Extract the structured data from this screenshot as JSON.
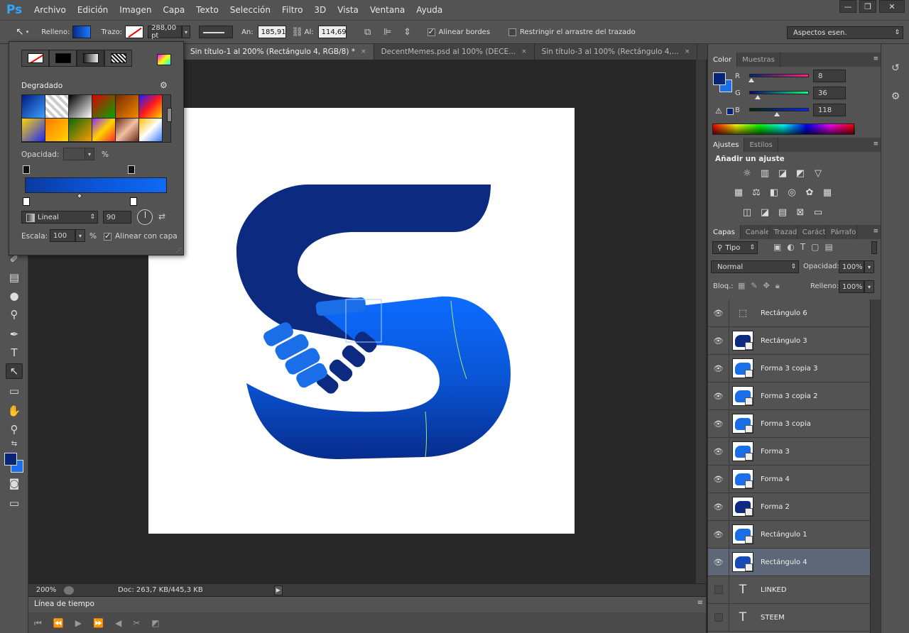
{
  "app": {
    "logo": "Ps",
    "menu": [
      "Archivo",
      "Edición",
      "Imagen",
      "Capa",
      "Texto",
      "Selección",
      "Filtro",
      "3D",
      "Vista",
      "Ventana",
      "Ayuda"
    ],
    "window_controls": [
      "—",
      "❐",
      "✕"
    ]
  },
  "options": {
    "fill_label": "Relleno:",
    "stroke_label": "Trazo:",
    "stroke_width": "288,00 pt",
    "width_label": "An:",
    "width_value": "185,91",
    "height_label": "Al:",
    "height_value": "114,69",
    "align_edges_label": "Alinear bordes",
    "align_edges_checked": true,
    "restrict_label": "Restringir el arrastre del trazado",
    "restrict_checked": false,
    "workspace": "Aspectos esen."
  },
  "tabs": [
    {
      "label": "Sin título-1 al 200% (Rectángulo 4, RGB/8) *",
      "close": "×",
      "active": true
    },
    {
      "label": "DecentMemes.psd al 100% (DECE...",
      "close": "×",
      "active": false
    },
    {
      "label": "Sin título-3 al 100% (Rectángulo 4,...",
      "close": "×",
      "active": false
    }
  ],
  "gradient_popup": {
    "title": "Degradado",
    "opacity_label": "Opacidad:",
    "opacity_unit": "%",
    "type": "Lineal",
    "angle": "90",
    "scale_label": "Escala:",
    "scale_value": "100",
    "scale_unit": "%",
    "align_label": "Alinear con capa",
    "align_checked": true,
    "preset_colors": [
      "linear-gradient(135deg,#001a80,#3ea0ff)",
      "repeating-linear-gradient(45deg,#ccc 0 4px,#fff 4px 8px)",
      "linear-gradient(135deg,#000,#fff)",
      "linear-gradient(135deg,#d00,#0a0)",
      "linear-gradient(135deg,#7a2a00,#f28b00)",
      "linear-gradient(135deg,#1a1aff,#ff1a1a,#ffd400)",
      "linear-gradient(135deg,#ffd400,#1a2aff)",
      "linear-gradient(135deg,#ff7a00,#ffd400)",
      "linear-gradient(135deg,#0a6a0a,#ff9a00)",
      "linear-gradient(135deg,#8a2aff,#ffd400,#ff2a2a)",
      "linear-gradient(135deg,#6a2a1a,#f2c0a0,#6a2a1a)",
      "linear-gradient(135deg,#ffc000,#fff,#3a7aff)"
    ]
  },
  "colors": {
    "foreground": "#082476",
    "background": "#1a6ee8",
    "gradient_dark": "#0a3aa0",
    "gradient_light": "#0e6af5"
  },
  "color_panel": {
    "tabs": [
      "Color",
      "Muestras"
    ],
    "channels": [
      {
        "label": "R",
        "value": "8",
        "fraction": 0.03
      },
      {
        "label": "G",
        "value": "36",
        "fraction": 0.14
      },
      {
        "label": "B",
        "value": "118",
        "fraction": 0.46
      }
    ]
  },
  "adjustments": {
    "tabs": [
      "Ajustes",
      "Estilos"
    ],
    "heading": "Añadir un ajuste",
    "icons_row1": [
      "☼",
      "▥",
      "◪",
      "◩",
      "▽"
    ],
    "icons_row2": [
      "▦",
      "⚖",
      "◧",
      "◎",
      "✿",
      "▦"
    ],
    "icons_row3": [
      "◫",
      "◪",
      "▤",
      "⊠",
      "▭"
    ]
  },
  "layers_panel": {
    "tabs": [
      "Capas",
      "Canales",
      "Trazados",
      "Carácter",
      "Párrafo"
    ],
    "filter": "Tipo",
    "blend_mode": "Normal",
    "opacity_label": "Opacidad:",
    "opacity_value": "100%",
    "lock_label": "Bloq.:",
    "fill_label": "Relleno:",
    "fill_value": "100%",
    "layers": [
      {
        "name": "Rectángulo 6",
        "kind": "rect6",
        "visible": true,
        "selected": false
      },
      {
        "name": "Rectángulo 3",
        "kind": "shape",
        "color": "#0b2a80",
        "visible": true,
        "selected": false
      },
      {
        "name": "Forma 3 copia 3",
        "kind": "shape",
        "color": "#1a6ee8",
        "visible": true,
        "selected": false
      },
      {
        "name": "Forma 3 copia 2",
        "kind": "shape",
        "color": "#1a6ee8",
        "visible": true,
        "selected": false
      },
      {
        "name": "Forma 3 copia",
        "kind": "shape",
        "color": "#1a6ee8",
        "visible": true,
        "selected": false
      },
      {
        "name": "Forma 3",
        "kind": "shape",
        "color": "#1a6ee8",
        "visible": true,
        "selected": false
      },
      {
        "name": "Forma 4",
        "kind": "shape",
        "color": "#1a6ee8",
        "visible": true,
        "selected": false
      },
      {
        "name": "Forma 2",
        "kind": "shape",
        "color": "#0b2a80",
        "visible": true,
        "selected": false
      },
      {
        "name": "Rectángulo 1",
        "kind": "shape",
        "color": "#1a6ee8",
        "visible": true,
        "selected": false
      },
      {
        "name": "Rectángulo 4",
        "kind": "shape",
        "color": "#1a4ab8",
        "visible": true,
        "selected": true
      },
      {
        "name": "LINKED",
        "kind": "text",
        "visible": false,
        "selected": false
      },
      {
        "name": "STEEM",
        "kind": "text",
        "visible": false,
        "selected": false
      }
    ]
  },
  "status": {
    "zoom": "200%",
    "doc_info": "Doc: 263,7 KB/445,3 KB"
  },
  "timeline": {
    "title": "Línea de tiempo"
  }
}
